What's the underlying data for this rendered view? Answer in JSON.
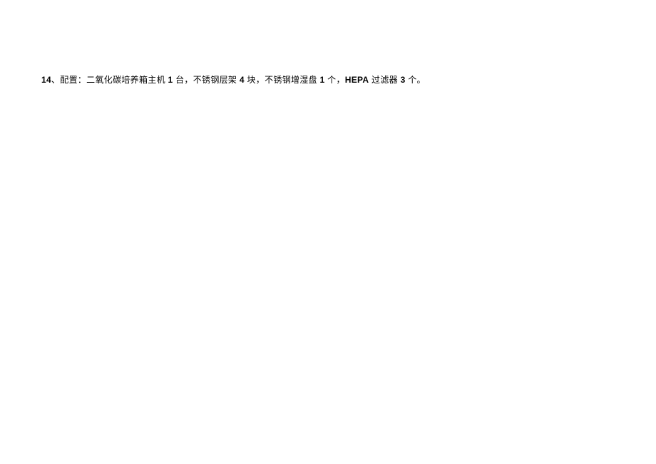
{
  "item": {
    "number_label": "14",
    "separator": "、",
    "prefix": "配置：",
    "part1a": "二氧化碳培养箱主机 ",
    "qty1": "1",
    "part1b": " 台，不锈钢层架 ",
    "qty2": "4",
    "part1c": " 块，不锈钢增湿盘 ",
    "qty3": "1",
    "part1d": " 个，",
    "hepa": "HEPA",
    "part1e": " 过滤器 ",
    "qty4": "3",
    "part1f": " 个。"
  }
}
